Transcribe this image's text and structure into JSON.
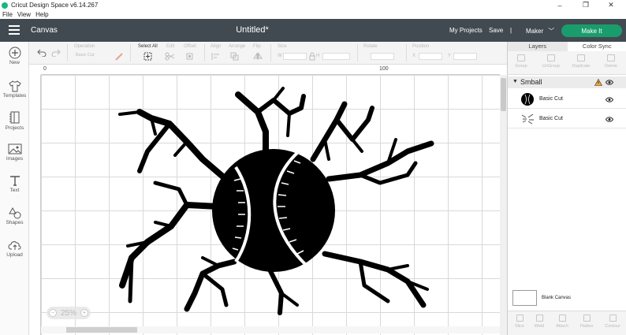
{
  "window": {
    "title": "Cricut Design Space  v6.14.267",
    "controls": [
      "–",
      "❐",
      "✕"
    ]
  },
  "menu": [
    "File",
    "View",
    "Help"
  ],
  "header": {
    "section": "Canvas",
    "document_title": "Untitled*",
    "my_projects": "My Projects",
    "save": "Save",
    "separator": "|",
    "machine": "Maker",
    "make_it": "Make It",
    "colors": {
      "header_bg": "#414a51",
      "make_it": "#1a9d6c"
    }
  },
  "sidebar": {
    "items": [
      {
        "label": "New",
        "icon": "plus-icon"
      },
      {
        "label": "Templates",
        "icon": "shirt-icon"
      },
      {
        "label": "Projects",
        "icon": "projects-icon"
      },
      {
        "label": "Images",
        "icon": "image-icon"
      },
      {
        "label": "Text",
        "icon": "text-icon"
      },
      {
        "label": "Shapes",
        "icon": "shapes-icon"
      },
      {
        "label": "Upload",
        "icon": "upload-icon"
      }
    ]
  },
  "toolbar": {
    "operation_label": "Operation",
    "operation_value": "Basic Cut",
    "select_all": "Select All",
    "edit": "Edit",
    "offset": "Offset",
    "align": "Align",
    "arrange": "Arrange",
    "flip": "Flip",
    "size": "Size",
    "size_w": "W",
    "size_h": "H",
    "rotate": "Rotate",
    "position": "Position",
    "pos_x": "X",
    "pos_y": "Y"
  },
  "canvas": {
    "ruler_marks": [
      "0",
      "100"
    ],
    "zoom": "25%",
    "zoom_minus": "−",
    "zoom_plus": "+"
  },
  "layers_panel": {
    "tabs": [
      "Layers",
      "Color Sync"
    ],
    "tools": [
      "Group",
      "UnGroup",
      "Duplicate",
      "Delete"
    ],
    "group_name": "Smball",
    "layers": [
      {
        "name": "Basic Cut",
        "thumb": "baseball-thumb-icon"
      },
      {
        "name": "Basic Cut",
        "thumb": "cracks-thumb-icon"
      }
    ],
    "blank_canvas": "Blank Canvas",
    "bottom_tools": [
      "Slice",
      "Weld",
      "Attach",
      "Flatten",
      "Contour"
    ]
  }
}
